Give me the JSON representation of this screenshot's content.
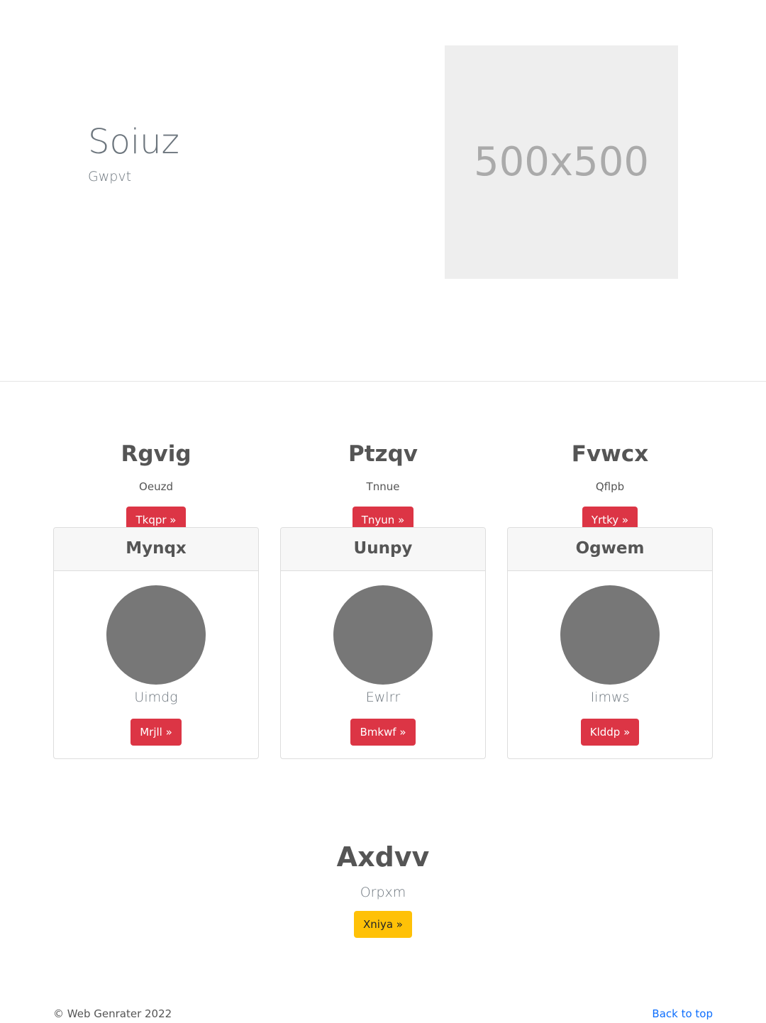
{
  "hero": {
    "title": "Soiuz",
    "subtitle": "Gwpvt",
    "image_text": "500x500"
  },
  "features": [
    {
      "title": "Rgvig",
      "subtitle": "Oeuzd",
      "button": "Tkqpr »"
    },
    {
      "title": "Ptzqv",
      "subtitle": "Tnnue",
      "button": "Tnyun »"
    },
    {
      "title": "Fvwcx",
      "subtitle": "Qflpb",
      "button": "Yrtky »"
    }
  ],
  "cards": [
    {
      "header": "Mynqx",
      "name": "Uimdg",
      "button": "Mrjll »"
    },
    {
      "header": "Uunpy",
      "name": "Ewlrr",
      "button": "Bmkwf »"
    },
    {
      "header": "Ogwem",
      "name": "Iimws",
      "button": "Klddp »"
    }
  ],
  "cta": {
    "title": "Axdvv",
    "subtitle": "Orpxm",
    "button": "Xniya »"
  },
  "footer": {
    "copyright": "© Web Genrater 2022",
    "back_to_top": "Back to top"
  },
  "colors": {
    "danger": "#dc3545",
    "warning": "#ffc107",
    "link": "#0d6efd",
    "avatar": "#777777"
  }
}
